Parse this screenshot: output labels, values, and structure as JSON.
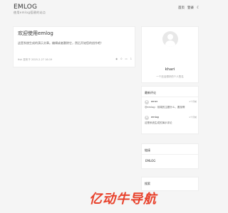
{
  "header": {
    "logo": "EMLOG",
    "tagline": "使用emlog搭建的站点",
    "nav": [
      "首页",
      "登录"
    ],
    "theme_icon": "moon-icon"
  },
  "post": {
    "title": "欢迎使用emlog",
    "excerpt": "这是系统生成的演示文章。编辑或者删除它，然后开始您的创作吧！",
    "meta": "fish  发布于 2025-2-27 16:19",
    "views": "0",
    "comments": "1",
    "views_icon": "eye-icon",
    "comments_icon": "comment-icon"
  },
  "profile": {
    "name": "khari",
    "description": "一个还没想好的个人签名"
  },
  "recent_comments": {
    "title": "最新评论",
    "items": [
      {
        "author": "emer",
        "time": "1个月前",
        "text": "@emlog：前端的主题什么，要找啊"
      },
      {
        "author": "emlog",
        "time": "1个月前",
        "text": "这是系统生成的演示评论"
      }
    ]
  },
  "links": {
    "title": "链接",
    "items": [
      "EMLOG"
    ]
  },
  "search": {
    "title": "搜索"
  },
  "watermark": {
    "text": "亿动牛导航"
  }
}
